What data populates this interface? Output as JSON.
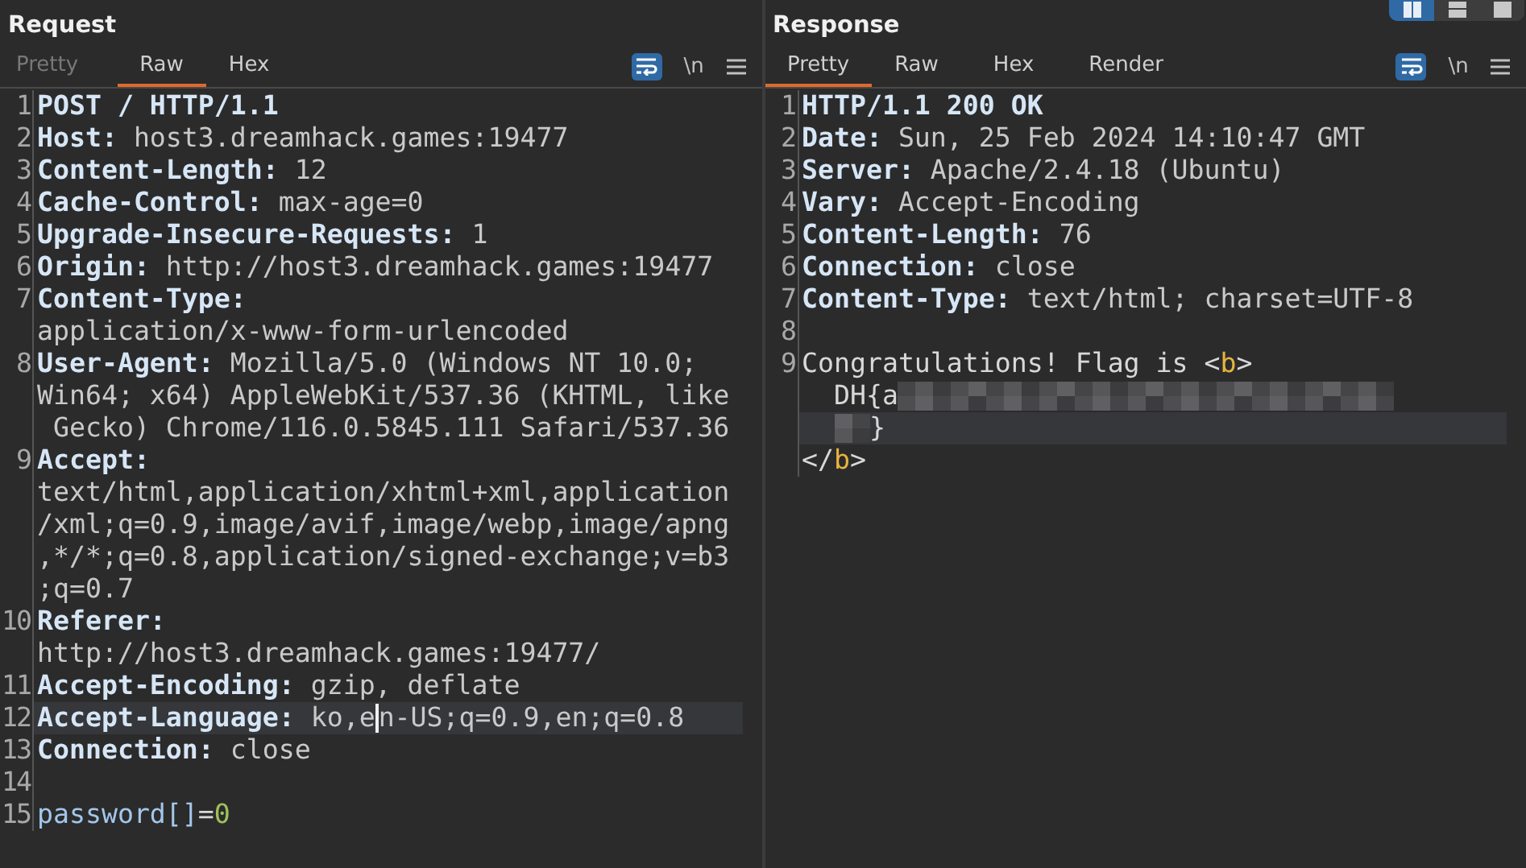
{
  "layout_buttons": [
    {
      "kind": "columns",
      "selected": true
    },
    {
      "kind": "rows",
      "selected": false
    },
    {
      "kind": "single",
      "selected": false
    }
  ],
  "panes": [
    {
      "title": "Request",
      "tabs": [
        {
          "label": "Pretty",
          "selected": false,
          "disabled": true
        },
        {
          "label": "Raw",
          "selected": true,
          "disabled": false
        },
        {
          "label": "Hex",
          "selected": false,
          "disabled": false
        }
      ],
      "tools": {
        "wrap_on": true,
        "newline_label": "\\n"
      },
      "lines": [
        {
          "number": "1",
          "rows": [
            {
              "highlighted": false,
              "spans": [
                {
                  "kind": "key",
                  "text": "POST / HTTP/1.1"
                }
              ]
            }
          ]
        },
        {
          "number": "2",
          "rows": [
            {
              "highlighted": false,
              "spans": [
                {
                  "kind": "key",
                  "text": "Host:"
                },
                {
                  "kind": "value",
                  "text": " host3.dreamhack.games:19477"
                }
              ]
            }
          ]
        },
        {
          "number": "3",
          "rows": [
            {
              "highlighted": false,
              "spans": [
                {
                  "kind": "key",
                  "text": "Content-Length:"
                },
                {
                  "kind": "value",
                  "text": " 12"
                }
              ]
            }
          ]
        },
        {
          "number": "4",
          "rows": [
            {
              "highlighted": false,
              "spans": [
                {
                  "kind": "key",
                  "text": "Cache-Control:"
                },
                {
                  "kind": "value",
                  "text": " max-age=0"
                }
              ]
            }
          ]
        },
        {
          "number": "5",
          "rows": [
            {
              "highlighted": false,
              "spans": [
                {
                  "kind": "key",
                  "text": "Upgrade-Insecure-Requests:"
                },
                {
                  "kind": "value",
                  "text": " 1"
                }
              ]
            }
          ]
        },
        {
          "number": "6",
          "rows": [
            {
              "highlighted": false,
              "spans": [
                {
                  "kind": "key",
                  "text": "Origin:"
                },
                {
                  "kind": "value",
                  "text": " http://host3.dreamhack.games:19477"
                }
              ]
            }
          ]
        },
        {
          "number": "7",
          "rows": [
            {
              "highlighted": false,
              "spans": [
                {
                  "kind": "key",
                  "text": "Content-Type:"
                }
              ]
            },
            {
              "highlighted": false,
              "spans": [
                {
                  "kind": "value",
                  "text": "application/x-www-form-urlencoded"
                }
              ]
            }
          ]
        },
        {
          "number": "8",
          "rows": [
            {
              "highlighted": false,
              "spans": [
                {
                  "kind": "key",
                  "text": "User-Agent:"
                },
                {
                  "kind": "value",
                  "text": " Mozilla/5.0 (Windows NT 10.0;"
                }
              ]
            },
            {
              "highlighted": false,
              "spans": [
                {
                  "kind": "value",
                  "text": "Win64; x64) AppleWebKit/537.36 (KHTML, like"
                }
              ]
            },
            {
              "highlighted": false,
              "spans": [
                {
                  "kind": "value",
                  "text": " Gecko) Chrome/116.0.5845.111 Safari/537.36"
                }
              ]
            }
          ]
        },
        {
          "number": "9",
          "rows": [
            {
              "highlighted": false,
              "spans": [
                {
                  "kind": "key",
                  "text": "Accept:"
                }
              ]
            },
            {
              "highlighted": false,
              "spans": [
                {
                  "kind": "value",
                  "text": "text/html,application/xhtml+xml,application"
                }
              ]
            },
            {
              "highlighted": false,
              "spans": [
                {
                  "kind": "value",
                  "text": "/xml;q=0.9,image/avif,image/webp,image/apng"
                }
              ]
            },
            {
              "highlighted": false,
              "spans": [
                {
                  "kind": "value",
                  "text": ",*/*;q=0.8,application/signed-exchange;v=b3"
                }
              ]
            },
            {
              "highlighted": false,
              "spans": [
                {
                  "kind": "value",
                  "text": ";q=0.7"
                }
              ]
            }
          ]
        },
        {
          "number": "10",
          "rows": [
            {
              "highlighted": false,
              "spans": [
                {
                  "kind": "key",
                  "text": "Referer:"
                }
              ]
            },
            {
              "highlighted": false,
              "spans": [
                {
                  "kind": "value",
                  "text": "http://host3.dreamhack.games:19477/"
                }
              ]
            }
          ]
        },
        {
          "number": "11",
          "rows": [
            {
              "highlighted": false,
              "spans": [
                {
                  "kind": "key",
                  "text": "Accept-Encoding:"
                },
                {
                  "kind": "value",
                  "text": " gzip, deflate"
                }
              ]
            }
          ]
        },
        {
          "number": "12",
          "rows": [
            {
              "highlighted": true,
              "spans": [
                {
                  "kind": "key",
                  "text": "Accept-Language:"
                },
                {
                  "kind": "value",
                  "text": " ko,e"
                },
                {
                  "kind": "caret"
                },
                {
                  "kind": "value",
                  "text": "n-US;q=0.9,en;q=0.8"
                }
              ]
            }
          ]
        },
        {
          "number": "13",
          "rows": [
            {
              "highlighted": false,
              "spans": [
                {
                  "kind": "key",
                  "text": "Connection:"
                },
                {
                  "kind": "value",
                  "text": " close"
                }
              ]
            }
          ]
        },
        {
          "number": "14",
          "rows": [
            {
              "highlighted": false,
              "spans": []
            }
          ]
        },
        {
          "number": "15",
          "rows": [
            {
              "highlighted": false,
              "spans": [
                {
                  "kind": "param",
                  "text": "password[]"
                },
                {
                  "kind": "plain",
                  "text": "="
                },
                {
                  "kind": "number",
                  "text": "0"
                }
              ]
            }
          ]
        }
      ]
    },
    {
      "title": "Response",
      "tabs": [
        {
          "label": "Pretty",
          "selected": true,
          "disabled": false
        },
        {
          "label": "Raw",
          "selected": false,
          "disabled": false
        },
        {
          "label": "Hex",
          "selected": false,
          "disabled": false
        },
        {
          "label": "Render",
          "selected": false,
          "disabled": false
        }
      ],
      "tools": {
        "wrap_on": true,
        "newline_label": "\\n"
      },
      "lines": [
        {
          "number": "1",
          "rows": [
            {
              "highlighted": false,
              "spans": [
                {
                  "kind": "key",
                  "text": "HTTP/1.1 200 OK"
                }
              ]
            }
          ]
        },
        {
          "number": "2",
          "rows": [
            {
              "highlighted": false,
              "spans": [
                {
                  "kind": "key",
                  "text": "Date:"
                },
                {
                  "kind": "value",
                  "text": " Sun, 25 Feb 2024 14:10:47 GMT"
                }
              ]
            }
          ]
        },
        {
          "number": "3",
          "rows": [
            {
              "highlighted": false,
              "spans": [
                {
                  "kind": "key",
                  "text": "Server:"
                },
                {
                  "kind": "value",
                  "text": " Apache/2.4.18 (Ubuntu)"
                }
              ]
            }
          ]
        },
        {
          "number": "4",
          "rows": [
            {
              "highlighted": false,
              "spans": [
                {
                  "kind": "key",
                  "text": "Vary:"
                },
                {
                  "kind": "value",
                  "text": " Accept-Encoding"
                }
              ]
            }
          ]
        },
        {
          "number": "5",
          "rows": [
            {
              "highlighted": false,
              "spans": [
                {
                  "kind": "key",
                  "text": "Content-Length:"
                },
                {
                  "kind": "value",
                  "text": " 76"
                }
              ]
            }
          ]
        },
        {
          "number": "6",
          "rows": [
            {
              "highlighted": false,
              "spans": [
                {
                  "kind": "key",
                  "text": "Connection:"
                },
                {
                  "kind": "value",
                  "text": " close"
                }
              ]
            }
          ]
        },
        {
          "number": "7",
          "rows": [
            {
              "highlighted": false,
              "spans": [
                {
                  "kind": "key",
                  "text": "Content-Type:"
                },
                {
                  "kind": "value",
                  "text": " text/html; charset=UTF-8"
                }
              ]
            }
          ]
        },
        {
          "number": "8",
          "rows": [
            {
              "highlighted": false,
              "spans": []
            }
          ]
        },
        {
          "number": "9",
          "rows": [
            {
              "highlighted": false,
              "spans": [
                {
                  "kind": "plain",
                  "text": "Congratulations! Flag is <"
                },
                {
                  "kind": "tag",
                  "text": "b"
                },
                {
                  "kind": "plain",
                  "text": ">"
                }
              ]
            },
            {
              "highlighted": false,
              "spans": [
                {
                  "kind": "plain",
                  "text": "  DH{a"
                },
                {
                  "kind": "redacted"
                }
              ]
            },
            {
              "highlighted": true,
              "spans": [
                {
                  "kind": "redacted_short"
                },
                {
                  "kind": "plain",
                  "text": "}"
                }
              ]
            },
            {
              "highlighted": false,
              "spans": [
                {
                  "kind": "plain",
                  "text": "</"
                },
                {
                  "kind": "tag",
                  "text": "b"
                },
                {
                  "kind": "plain",
                  "text": ">"
                }
              ]
            }
          ]
        }
      ]
    }
  ]
}
